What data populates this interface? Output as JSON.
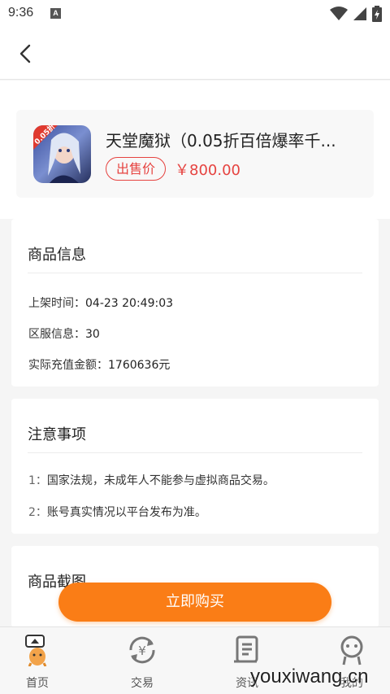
{
  "status_bar": {
    "time": "9:36",
    "notification_letter": "A"
  },
  "header": {
    "back_icon": "chevron-left-icon"
  },
  "product": {
    "icon_badge": "0.05折",
    "title": "天堂魔狱（0.05折百倍爆率千...",
    "sale_tag": "出售价",
    "price": "￥800.00"
  },
  "goods_info": {
    "title": "商品信息",
    "rows": [
      {
        "label": "上架时间：",
        "value": "04-23 20:49:03"
      },
      {
        "label": "区服信息：",
        "value": "30"
      },
      {
        "label": "实际充值金额：",
        "value": "1760636元"
      }
    ]
  },
  "notice": {
    "title": "注意事项",
    "items": [
      {
        "num": "1：",
        "text": "国家法规，未成年人不能参与虚拟商品交易。"
      },
      {
        "num": "2：",
        "text": "账号真实情况以平台发布为准。"
      }
    ]
  },
  "screenshots": {
    "title": "商品截图"
  },
  "buy_button": {
    "label": "立即购买",
    "color": "#fa7d16"
  },
  "tabbar": {
    "items": [
      {
        "label": "首页",
        "icon": "home-mascot-icon"
      },
      {
        "label": "交易",
        "icon": "exchange-icon"
      },
      {
        "label": "资讯",
        "icon": "news-scroll-icon"
      },
      {
        "label": "我的",
        "icon": "profile-face-icon"
      }
    ]
  },
  "watermark": "youxiwang.cn",
  "colors": {
    "accent": "#fa7d16",
    "price_red": "#e64340"
  }
}
